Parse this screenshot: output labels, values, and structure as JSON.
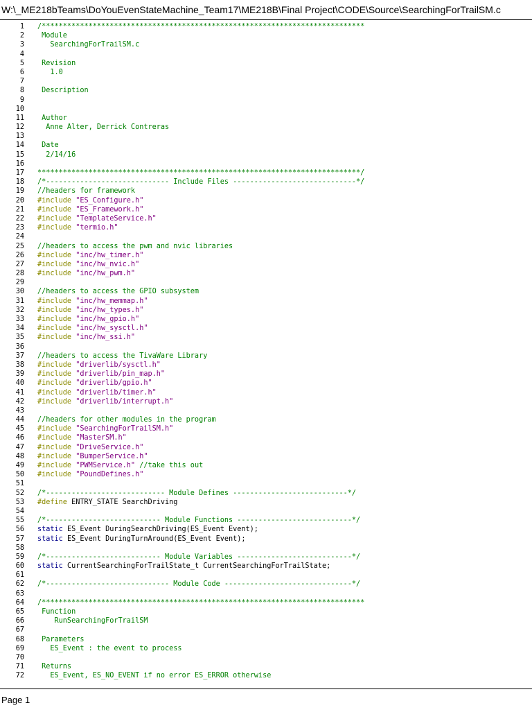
{
  "header": {
    "file_path": "W:\\_ME218bTeams\\DoYouEvenStateMachine_Team17\\ME218B\\Final Project\\CODE\\Source\\SearchingForTrailSM.c"
  },
  "footer": {
    "page_label": "Page 1"
  },
  "colors": {
    "comment": "#008000",
    "preprocessor": "#8b8b00",
    "string": "#800080",
    "keyword": "#00008b",
    "text": "#000000"
  },
  "code_lines": [
    {
      "num": "1",
      "parts": [
        {
          "t": "/****************************************************************************",
          "c": "c"
        }
      ]
    },
    {
      "num": "2",
      "parts": [
        {
          "t": " Module",
          "c": "c"
        }
      ]
    },
    {
      "num": "3",
      "parts": [
        {
          "t": "   SearchingForTrailSM.c",
          "c": "c"
        }
      ]
    },
    {
      "num": "4",
      "parts": []
    },
    {
      "num": "5",
      "parts": [
        {
          "t": " Revision",
          "c": "c"
        }
      ]
    },
    {
      "num": "6",
      "parts": [
        {
          "t": "   1.0",
          "c": "c"
        }
      ]
    },
    {
      "num": "7",
      "parts": []
    },
    {
      "num": "8",
      "parts": [
        {
          "t": " Description",
          "c": "c"
        }
      ]
    },
    {
      "num": "9",
      "parts": []
    },
    {
      "num": "10",
      "parts": []
    },
    {
      "num": "11",
      "parts": [
        {
          "t": " Author",
          "c": "c"
        }
      ]
    },
    {
      "num": "12",
      "parts": [
        {
          "t": "  Anne Alter, Derrick Contreras",
          "c": "c"
        }
      ]
    },
    {
      "num": "13",
      "parts": []
    },
    {
      "num": "14",
      "parts": [
        {
          "t": " Date",
          "c": "c"
        }
      ]
    },
    {
      "num": "15",
      "parts": [
        {
          "t": "  2/14/16",
          "c": "c"
        }
      ]
    },
    {
      "num": "16",
      "parts": []
    },
    {
      "num": "17",
      "parts": [
        {
          "t": "****************************************************************************/",
          "c": "c"
        }
      ]
    },
    {
      "num": "18",
      "parts": [
        {
          "t": "/*----------------------------- Include Files -----------------------------*/",
          "c": "c"
        }
      ]
    },
    {
      "num": "19",
      "parts": [
        {
          "t": "//headers for framework",
          "c": "c"
        }
      ]
    },
    {
      "num": "20",
      "parts": [
        {
          "t": "#include ",
          "c": "p"
        },
        {
          "t": "\"ES_Configure.h\"",
          "c": "s"
        }
      ]
    },
    {
      "num": "21",
      "parts": [
        {
          "t": "#include ",
          "c": "p"
        },
        {
          "t": "\"ES_Framework.h\"",
          "c": "s"
        }
      ]
    },
    {
      "num": "22",
      "parts": [
        {
          "t": "#include ",
          "c": "p"
        },
        {
          "t": "\"TemplateService.h\"",
          "c": "s"
        }
      ]
    },
    {
      "num": "23",
      "parts": [
        {
          "t": "#include ",
          "c": "p"
        },
        {
          "t": "\"termio.h\"",
          "c": "s"
        }
      ]
    },
    {
      "num": "24",
      "parts": []
    },
    {
      "num": "25",
      "parts": [
        {
          "t": "//headers to access the pwm and nvic libraries",
          "c": "c"
        }
      ]
    },
    {
      "num": "26",
      "parts": [
        {
          "t": "#include ",
          "c": "p"
        },
        {
          "t": "\"inc/hw_timer.h\"",
          "c": "s"
        }
      ]
    },
    {
      "num": "27",
      "parts": [
        {
          "t": "#include ",
          "c": "p"
        },
        {
          "t": "\"inc/hw_nvic.h\"",
          "c": "s"
        }
      ]
    },
    {
      "num": "28",
      "parts": [
        {
          "t": "#include ",
          "c": "p"
        },
        {
          "t": "\"inc/hw_pwm.h\"",
          "c": "s"
        }
      ]
    },
    {
      "num": "29",
      "parts": []
    },
    {
      "num": "30",
      "parts": [
        {
          "t": "//headers to access the GPIO subsystem",
          "c": "c"
        }
      ]
    },
    {
      "num": "31",
      "parts": [
        {
          "t": "#include ",
          "c": "p"
        },
        {
          "t": "\"inc/hw_memmap.h\"",
          "c": "s"
        }
      ]
    },
    {
      "num": "32",
      "parts": [
        {
          "t": "#include ",
          "c": "p"
        },
        {
          "t": "\"inc/hw_types.h\"",
          "c": "s"
        }
      ]
    },
    {
      "num": "33",
      "parts": [
        {
          "t": "#include ",
          "c": "p"
        },
        {
          "t": "\"inc/hw_gpio.h\"",
          "c": "s"
        }
      ]
    },
    {
      "num": "34",
      "parts": [
        {
          "t": "#include ",
          "c": "p"
        },
        {
          "t": "\"inc/hw_sysctl.h\"",
          "c": "s"
        }
      ]
    },
    {
      "num": "35",
      "parts": [
        {
          "t": "#include ",
          "c": "p"
        },
        {
          "t": "\"inc/hw_ssi.h\"",
          "c": "s"
        }
      ]
    },
    {
      "num": "36",
      "parts": []
    },
    {
      "num": "37",
      "parts": [
        {
          "t": "//headers to access the TivaWare Library",
          "c": "c"
        }
      ]
    },
    {
      "num": "38",
      "parts": [
        {
          "t": "#include ",
          "c": "p"
        },
        {
          "t": "\"driverlib/sysctl.h\"",
          "c": "s"
        }
      ]
    },
    {
      "num": "39",
      "parts": [
        {
          "t": "#include ",
          "c": "p"
        },
        {
          "t": "\"driverlib/pin_map.h\"",
          "c": "s"
        }
      ]
    },
    {
      "num": "40",
      "parts": [
        {
          "t": "#include ",
          "c": "p"
        },
        {
          "t": "\"driverlib/gpio.h\"",
          "c": "s"
        }
      ]
    },
    {
      "num": "41",
      "parts": [
        {
          "t": "#include ",
          "c": "p"
        },
        {
          "t": "\"driverlib/timer.h\"",
          "c": "s"
        }
      ]
    },
    {
      "num": "42",
      "parts": [
        {
          "t": "#include ",
          "c": "p"
        },
        {
          "t": "\"driverlib/interrupt.h\"",
          "c": "s"
        }
      ]
    },
    {
      "num": "43",
      "parts": []
    },
    {
      "num": "44",
      "parts": [
        {
          "t": "//headers for other modules in the program",
          "c": "c"
        }
      ]
    },
    {
      "num": "45",
      "parts": [
        {
          "t": "#include ",
          "c": "p"
        },
        {
          "t": "\"SearchingForTrailSM.h\"",
          "c": "s"
        }
      ]
    },
    {
      "num": "46",
      "parts": [
        {
          "t": "#include ",
          "c": "p"
        },
        {
          "t": "\"MasterSM.h\"",
          "c": "s"
        }
      ]
    },
    {
      "num": "47",
      "parts": [
        {
          "t": "#include ",
          "c": "p"
        },
        {
          "t": "\"DriveService.h\"",
          "c": "s"
        }
      ]
    },
    {
      "num": "48",
      "parts": [
        {
          "t": "#include ",
          "c": "p"
        },
        {
          "t": "\"BumperService.h\"",
          "c": "s"
        }
      ]
    },
    {
      "num": "49",
      "parts": [
        {
          "t": "#include ",
          "c": "p"
        },
        {
          "t": "\"PWMService.h\"",
          "c": "s"
        },
        {
          "t": " //take this out",
          "c": "c"
        }
      ]
    },
    {
      "num": "50",
      "parts": [
        {
          "t": "#include ",
          "c": "p"
        },
        {
          "t": "\"PoundDefines.h\"",
          "c": "s"
        }
      ]
    },
    {
      "num": "51",
      "parts": []
    },
    {
      "num": "52",
      "parts": [
        {
          "t": "/*---------------------------- Module Defines ---------------------------*/",
          "c": "c"
        }
      ]
    },
    {
      "num": "53",
      "parts": [
        {
          "t": "#define ",
          "c": "p"
        },
        {
          "t": "ENTRY_STATE SearchDriving",
          "c": "n"
        }
      ]
    },
    {
      "num": "54",
      "parts": []
    },
    {
      "num": "55",
      "parts": [
        {
          "t": "/*--------------------------- Module Functions ---------------------------*/",
          "c": "c"
        }
      ]
    },
    {
      "num": "56",
      "parts": [
        {
          "t": "static ",
          "c": "k"
        },
        {
          "t": "ES_Event DuringSearchDriving(ES_Event Event);",
          "c": "n"
        }
      ]
    },
    {
      "num": "57",
      "parts": [
        {
          "t": "static ",
          "c": "k"
        },
        {
          "t": "ES_Event DuringTurnAround(ES_Event Event);",
          "c": "n"
        }
      ]
    },
    {
      "num": "58",
      "parts": []
    },
    {
      "num": "59",
      "parts": [
        {
          "t": "/*--------------------------- Module Variables ---------------------------*/",
          "c": "c"
        }
      ]
    },
    {
      "num": "60",
      "parts": [
        {
          "t": "static ",
          "c": "k"
        },
        {
          "t": "CurrentSearchingForTrailState_t CurrentSearchingForTrailState;",
          "c": "n"
        }
      ]
    },
    {
      "num": "61",
      "parts": []
    },
    {
      "num": "62",
      "parts": [
        {
          "t": "/*----------------------------- Module Code ------------------------------*/",
          "c": "c"
        }
      ]
    },
    {
      "num": "63",
      "parts": []
    },
    {
      "num": "64",
      "parts": [
        {
          "t": "/****************************************************************************",
          "c": "c"
        }
      ]
    },
    {
      "num": "65",
      "parts": [
        {
          "t": " Function",
          "c": "c"
        }
      ]
    },
    {
      "num": "66",
      "parts": [
        {
          "t": "    RunSearchingForTrailSM",
          "c": "c"
        }
      ]
    },
    {
      "num": "67",
      "parts": []
    },
    {
      "num": "68",
      "parts": [
        {
          "t": " Parameters",
          "c": "c"
        }
      ]
    },
    {
      "num": "69",
      "parts": [
        {
          "t": "   ES_Event : the event to process",
          "c": "c"
        }
      ]
    },
    {
      "num": "70",
      "parts": []
    },
    {
      "num": "71",
      "parts": [
        {
          "t": " Returns",
          "c": "c"
        }
      ]
    },
    {
      "num": "72",
      "parts": [
        {
          "t": "   ES_Event, ES_NO_EVENT if no error ES_ERROR otherwise",
          "c": "c"
        }
      ]
    }
  ]
}
